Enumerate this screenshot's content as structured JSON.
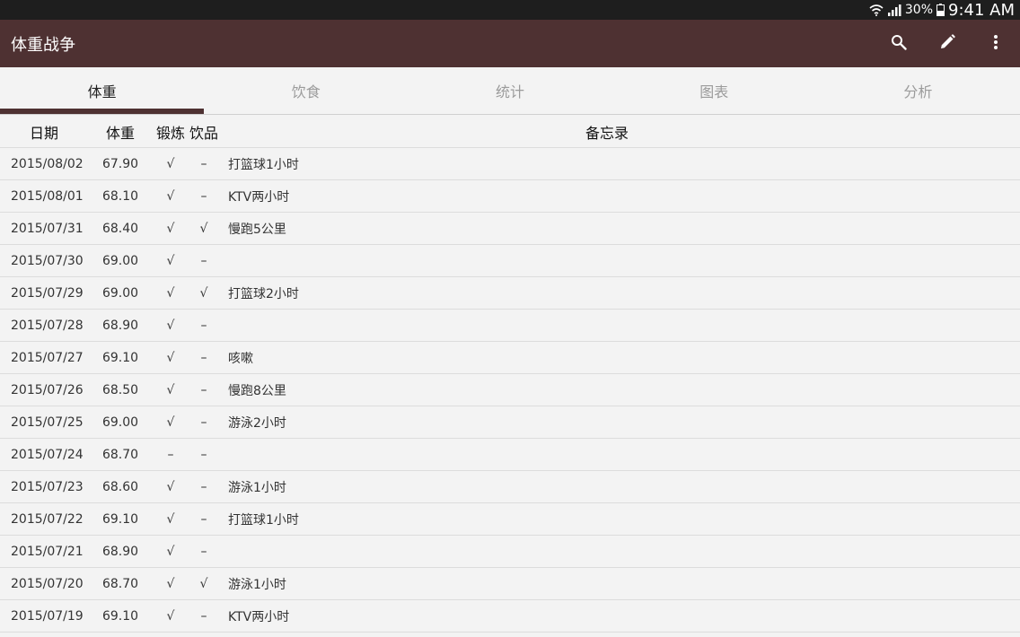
{
  "colors": {
    "app_bar": "#4e3132",
    "indicator": "#4e3132"
  },
  "status_bar": {
    "battery": "30%",
    "time": "9:41 AM",
    "icons": [
      "wifi-icon",
      "signal-icon",
      "battery-icon"
    ]
  },
  "app_bar": {
    "title": "体重战争",
    "actions": [
      "search-icon",
      "edit-icon",
      "more-vert-icon"
    ]
  },
  "tabs": [
    {
      "label": "体重",
      "active": true
    },
    {
      "label": "饮食",
      "active": false
    },
    {
      "label": "统计",
      "active": false
    },
    {
      "label": "图表",
      "active": false
    },
    {
      "label": "分析",
      "active": false
    }
  ],
  "table": {
    "headers": {
      "date": "日期",
      "weight": "体重",
      "exercise": "锻炼",
      "drink": "饮品",
      "memo": "备忘录"
    },
    "rows": [
      {
        "date": "2015/08/02",
        "weight": "67.90",
        "exercise": "√",
        "drink": "–",
        "memo": "打篮球1小时"
      },
      {
        "date": "2015/08/01",
        "weight": "68.10",
        "exercise": "√",
        "drink": "–",
        "memo": "KTV两小时"
      },
      {
        "date": "2015/07/31",
        "weight": "68.40",
        "exercise": "√",
        "drink": "√",
        "memo": "慢跑5公里"
      },
      {
        "date": "2015/07/30",
        "weight": "69.00",
        "exercise": "√",
        "drink": "–",
        "memo": ""
      },
      {
        "date": "2015/07/29",
        "weight": "69.00",
        "exercise": "√",
        "drink": "√",
        "memo": "打篮球2小时"
      },
      {
        "date": "2015/07/28",
        "weight": "68.90",
        "exercise": "√",
        "drink": "–",
        "memo": ""
      },
      {
        "date": "2015/07/27",
        "weight": "69.10",
        "exercise": "√",
        "drink": "–",
        "memo": "咳嗽"
      },
      {
        "date": "2015/07/26",
        "weight": "68.50",
        "exercise": "√",
        "drink": "–",
        "memo": "慢跑8公里"
      },
      {
        "date": "2015/07/25",
        "weight": "69.00",
        "exercise": "√",
        "drink": "–",
        "memo": "游泳2小时"
      },
      {
        "date": "2015/07/24",
        "weight": "68.70",
        "exercise": "–",
        "drink": "–",
        "memo": ""
      },
      {
        "date": "2015/07/23",
        "weight": "68.60",
        "exercise": "√",
        "drink": "–",
        "memo": "游泳1小时"
      },
      {
        "date": "2015/07/22",
        "weight": "69.10",
        "exercise": "√",
        "drink": "–",
        "memo": "打篮球1小时"
      },
      {
        "date": "2015/07/21",
        "weight": "68.90",
        "exercise": "√",
        "drink": "–",
        "memo": ""
      },
      {
        "date": "2015/07/20",
        "weight": "68.70",
        "exercise": "√",
        "drink": "√",
        "memo": "游泳1小时"
      },
      {
        "date": "2015/07/19",
        "weight": "69.10",
        "exercise": "√",
        "drink": "–",
        "memo": "KTV两小时"
      }
    ]
  }
}
